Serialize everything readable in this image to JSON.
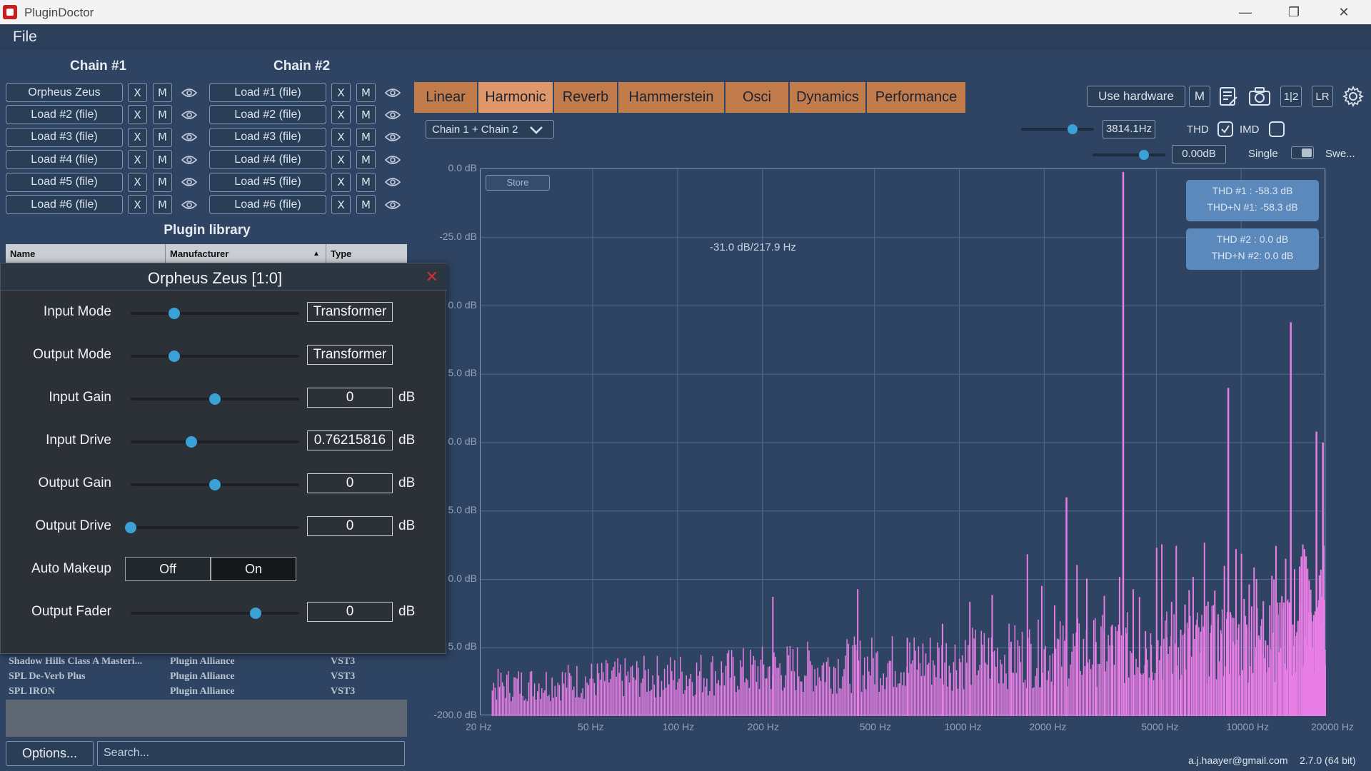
{
  "window": {
    "title": "PluginDoctor"
  },
  "menu": {
    "file": "File"
  },
  "chain1": {
    "title": "Chain #1",
    "slots": [
      "Orpheus Zeus",
      "Load #2 (file)",
      "Load #3 (file)",
      "Load #4 (file)",
      "Load #5 (file)",
      "Load #6 (file)"
    ]
  },
  "chain2": {
    "title": "Chain #2",
    "slots": [
      "Load #1 (file)",
      "Load #2 (file)",
      "Load #3 (file)",
      "Load #4 (file)",
      "Load #5 (file)",
      "Load #6 (file)"
    ]
  },
  "slot_buttons": {
    "remove": "X",
    "mute": "M"
  },
  "library": {
    "title": "Plugin library",
    "columns": {
      "name": "Name",
      "manufacturer": "Manufacturer",
      "type": "Type",
      "sort_indicator": "▲"
    },
    "rows": [
      {
        "name": "Shadow Hills Class A Masteri...",
        "manufacturer": "Plugin Alliance",
        "type": "VST3"
      },
      {
        "name": "SPL De-Verb Plus",
        "manufacturer": "Plugin Alliance",
        "type": "VST3"
      },
      {
        "name": "SPL IRON",
        "manufacturer": "Plugin Alliance",
        "type": "VST3"
      }
    ],
    "options": "Options...",
    "search_placeholder": "Search..."
  },
  "plugin_window": {
    "title": "Orpheus Zeus [1:0]",
    "close": "✕",
    "params": [
      {
        "label": "Input Mode",
        "value": "Transformer",
        "unit": "",
        "level": 0.26
      },
      {
        "label": "Output Mode",
        "value": "Transformer",
        "unit": "",
        "level": 0.26
      },
      {
        "label": "Input Gain",
        "value": "0",
        "unit": "dB",
        "level": 0.5
      },
      {
        "label": "Input Drive",
        "value": "0.76215816",
        "unit": "dB",
        "level": 0.36
      },
      {
        "label": "Output Gain",
        "value": "0",
        "unit": "dB",
        "level": 0.5
      },
      {
        "label": "Output Drive",
        "value": "0",
        "unit": "dB",
        "level": 0.0
      },
      {
        "label": "Auto Makeup",
        "off": "Off",
        "on": "On",
        "selected": "On"
      },
      {
        "label": "Output Fader",
        "value": "0",
        "unit": "dB",
        "level": 0.74
      }
    ]
  },
  "tabs": [
    "Linear",
    "Harmonic",
    "Reverb",
    "Hammerstein",
    "Osci",
    "Dynamics",
    "Performance"
  ],
  "active_tab": "Harmonic",
  "toolbar": {
    "use_hardware": "Use hardware",
    "mono": "M",
    "split": "1|2",
    "lr": "LR",
    "icons": [
      "notes-icon",
      "camera-icon",
      "settings-icon"
    ]
  },
  "analysis": {
    "chain_select": "Chain 1 + Chain 2",
    "freq_value": "3814.1Hz",
    "level_value": "0.00dB",
    "thd_label": "THD",
    "imd_label": "IMD",
    "thd_checked": true,
    "imd_checked": false,
    "single_label": "Single",
    "sweep_label": "Swe...",
    "freq_level": 0.71,
    "amp_level": 0.71
  },
  "plot": {
    "store": "Store",
    "cursor": "-31.0 dB/217.9 Hz",
    "y_ticks": [
      "0.0 dB",
      "-25.0 dB",
      "0.0 dB",
      "5.0 dB",
      "0.0 dB",
      "5.0 dB",
      "0.0 dB",
      "5.0 dB",
      "-200.0 dB"
    ],
    "x_ticks": [
      "20 Hz",
      "50 Hz",
      "100 Hz",
      "200 Hz",
      "500 Hz",
      "1000 Hz",
      "2000 Hz",
      "5000 Hz",
      "10000 Hz",
      "20000 Hz"
    ],
    "thd1": "THD #1 : -58.3 dB",
    "thdn1": "THD+N #1: -58.3 dB",
    "thd2": "THD #2 : 0.0 dB",
    "thdn2": "THD+N #2: 0.0 dB",
    "spectrum_color": "#e87ee6",
    "grid_color": "#4c6a90"
  },
  "footer": {
    "email": "a.j.haayer@gmail.com",
    "version": "2.7.0 (64 bit)"
  }
}
